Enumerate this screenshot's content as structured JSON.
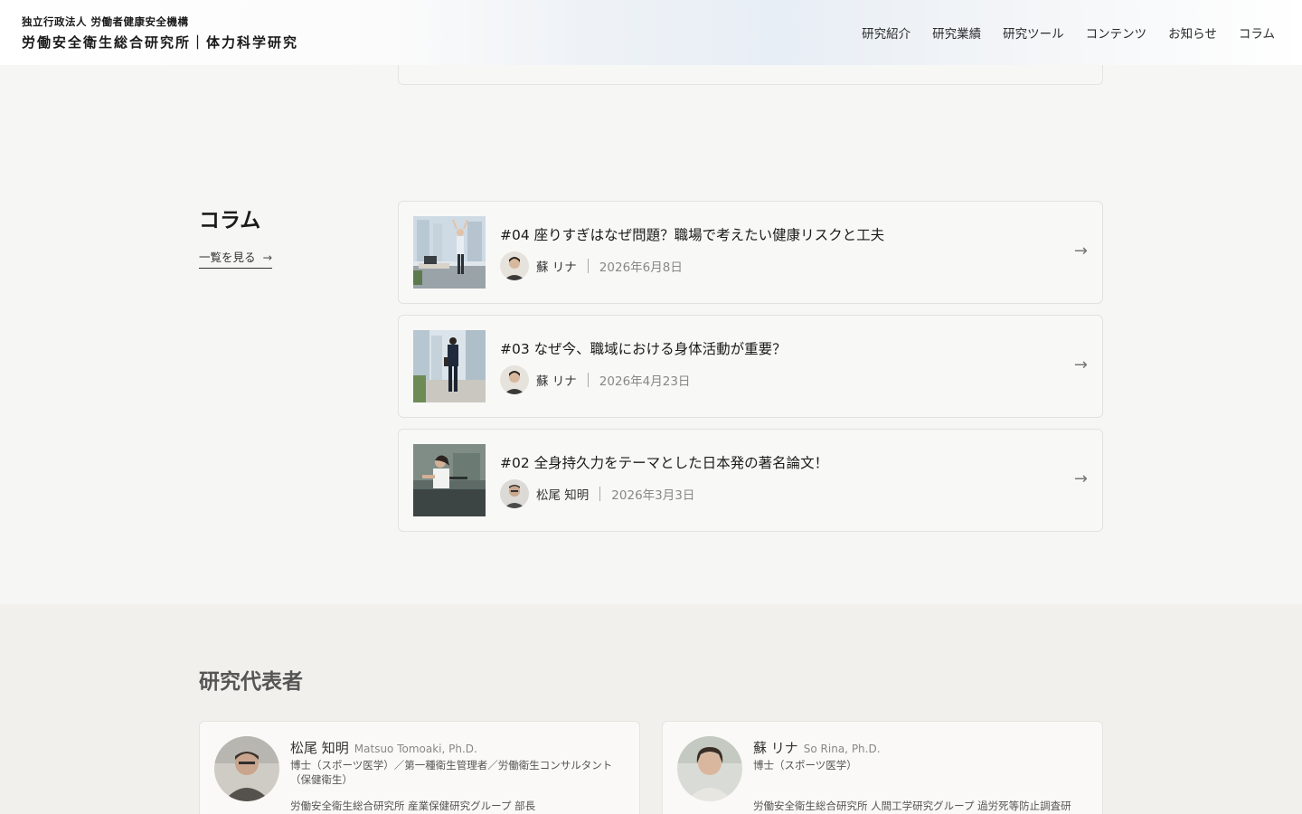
{
  "header": {
    "org_sub": "独立行政法人 労働者健康安全機構",
    "org_main": "労働安全衛生総合研究所｜体力科学研究",
    "nav": [
      "研究紹介",
      "研究業績",
      "研究ツール",
      "コンテンツ",
      "お知らせ",
      "コラム"
    ]
  },
  "column": {
    "title": "コラム",
    "see_all": "一覧を見る",
    "items": [
      {
        "title": "#04 座りすぎはなぜ問題？職場で考えたい健康リスクと工夫",
        "author": "蘇 リナ",
        "date": "2026年6月8日"
      },
      {
        "title": "#03 なぜ今、職域における身体活動が重要？",
        "author": "蘇 リナ",
        "date": "2026年4月23日"
      },
      {
        "title": "#02 全身持久力をテーマとした日本発の著名論文！",
        "author": "松尾 知明",
        "date": "2026年3月3日"
      }
    ]
  },
  "representatives": {
    "title": "研究代表者",
    "people": [
      {
        "name": "松尾 知明",
        "name_en": "Matsuo Tomoaki, Ph.D.",
        "degree": "博士（スポーツ医学）／第一種衛生管理者／労働衛生コンサルタント（保健衛生）",
        "affiliation": "労働安全衛生総合研究所 産業保健研究グループ 部長"
      },
      {
        "name": "蘇 リナ",
        "name_en": "So Rina, Ph.D.",
        "degree": "博士（スポーツ医学）",
        "affiliation": "労働安全衛生総合研究所 人間工学研究グループ 過労死等防止調査研"
      }
    ]
  }
}
